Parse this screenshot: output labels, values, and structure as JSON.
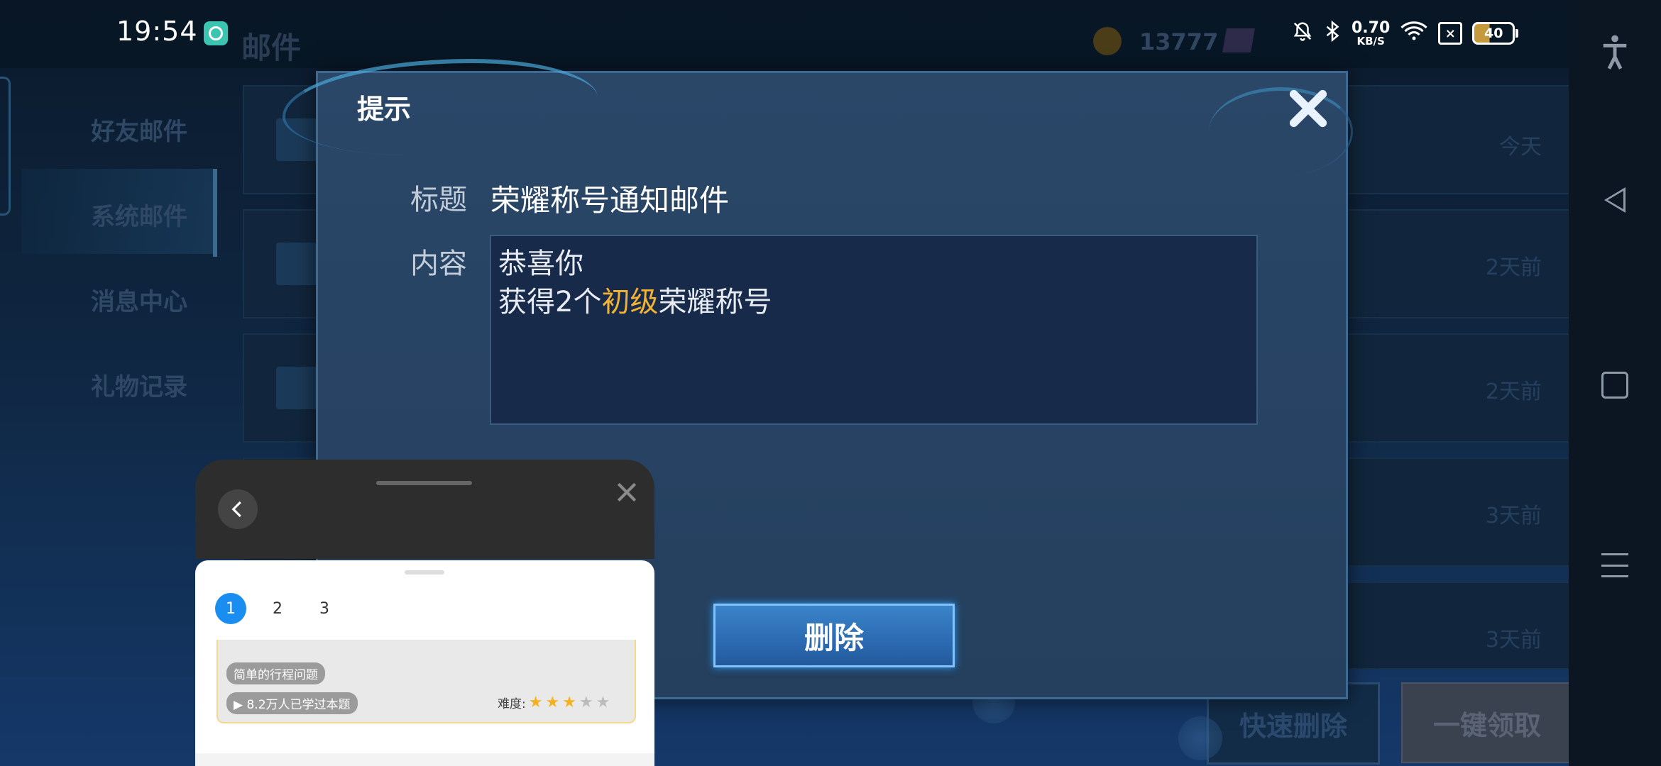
{
  "status_bar": {
    "time": "19:54",
    "net_speed_value": "0.70",
    "net_speed_unit": "KB/S",
    "battery": "40"
  },
  "background": {
    "mail_title": "邮件",
    "coins": "13777",
    "sidebar": [
      "好友邮件",
      "系统邮件",
      "消息中心",
      "礼物记录"
    ],
    "row_times": [
      "今天",
      "2天前",
      "2天前",
      "3天前",
      "3天前"
    ],
    "quick_delete": "快速删除",
    "claim_all": "一键领取"
  },
  "dialog": {
    "title": "提示",
    "subject_label": "标题",
    "subject_value": "荣耀称号通知邮件",
    "content_label": "内容",
    "content_line1": "恭喜你",
    "content_line2_prefix": "获得2个",
    "content_line2_highlight": "初级",
    "content_line2_suffix": "荣耀称号",
    "delete_button": "删除"
  },
  "float_panel": {
    "tabs": [
      "1",
      "2",
      "3"
    ],
    "active_tab": "1",
    "card": {
      "tag_title": "简单的行程问题",
      "learned": "▶ 8.2万人已学过本题",
      "difficulty_label": "难度:",
      "difficulty_stars": 3,
      "difficulty_max": 5
    }
  },
  "colors": {
    "highlight": "#f2b234",
    "active_tab": "#1a8ef0"
  }
}
